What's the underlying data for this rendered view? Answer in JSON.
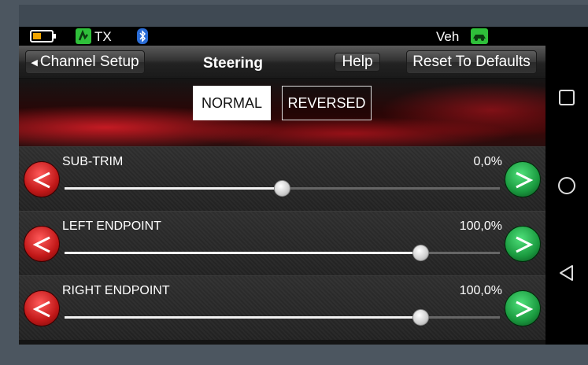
{
  "status_bar": {
    "tx_label": "TX",
    "veh_label": "Veh"
  },
  "header": {
    "back_label": "Channel Setup",
    "title": "Steering",
    "help_label": "Help",
    "reset_label": "Reset To Defaults"
  },
  "modes": {
    "normal_label": "NORMAL",
    "reversed_label": "REVERSED",
    "selected": "NORMAL"
  },
  "rows": [
    {
      "label": "SUB-TRIM",
      "value": "0,0%",
      "slider_fraction": 0.5
    },
    {
      "label": "LEFT ENDPOINT",
      "value": "100,0%",
      "slider_fraction": 0.82
    },
    {
      "label": "RIGHT ENDPOINT",
      "value": "100,0%",
      "slider_fraction": 0.82
    }
  ],
  "colors": {
    "accent_red": "#d81f26",
    "accent_green": "#1a9a3f",
    "battery": "#f0a500",
    "bluetooth": "#2a6cd6"
  },
  "icons": {
    "battery": "battery-icon",
    "tx": "transmitter-icon",
    "bluetooth": "bluetooth-icon",
    "vehicle": "vehicle-icon",
    "nav_square": "recent-apps-icon",
    "nav_circle": "home-icon",
    "nav_triangle": "back-icon"
  }
}
